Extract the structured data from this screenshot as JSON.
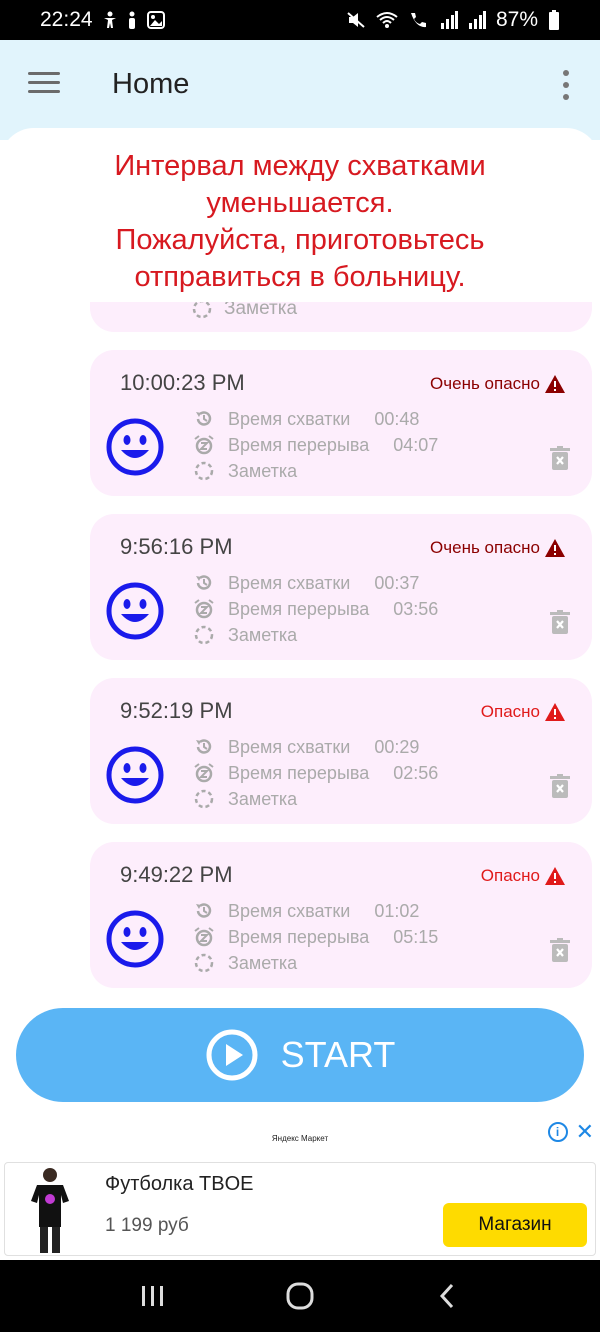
{
  "status_bar": {
    "time": "22:24",
    "battery": "87%",
    "icons_left": [
      "accessibility-icon",
      "person-icon",
      "gallery-icon"
    ],
    "icons_right": [
      "mute-icon",
      "wifi-icon",
      "wifi-call-icon",
      "signal-icon",
      "signal-icon",
      "battery-icon"
    ]
  },
  "appbar": {
    "title": "Home"
  },
  "warning": {
    "lines": [
      "Интервал между схватками",
      "уменьшается.",
      "Пожалуйста, приготовьтесь",
      "отправиться в больницу."
    ]
  },
  "partial_card": {
    "note_label": "Заметка"
  },
  "labels": {
    "contraction": "Время схватки",
    "break": "Время перерыва",
    "note": "Заметка"
  },
  "records": [
    {
      "time": "10:00:23 PM",
      "risk": "Очень опасно",
      "risk_color": "#8b0000",
      "contraction": "00:48",
      "break": "04:07"
    },
    {
      "time": "9:56:16 PM",
      "risk": "Очень опасно",
      "risk_color": "#8b0000",
      "contraction": "00:37",
      "break": "03:56"
    },
    {
      "time": "9:52:19 PM",
      "risk": "Опасно",
      "risk_color": "#e01a1a",
      "contraction": "00:29",
      "break": "02:56"
    },
    {
      "time": "9:49:22 PM",
      "risk": "Опасно",
      "risk_color": "#e01a1a",
      "contraction": "01:02",
      "break": "05:15"
    }
  ],
  "start_button": {
    "label": "START"
  },
  "ad": {
    "brand": "Яндекс Маркет",
    "title": "Футболка TBOE",
    "price": "1 199 руб",
    "button": "Магазин",
    "info": "i",
    "close": "✕"
  },
  "colors": {
    "appbar_bg": "#e1f4fc",
    "card_bg": "#fdeefc",
    "warning_text": "#d71920",
    "start_button": "#5ab5f5",
    "smiley": "#1a1aeb"
  }
}
